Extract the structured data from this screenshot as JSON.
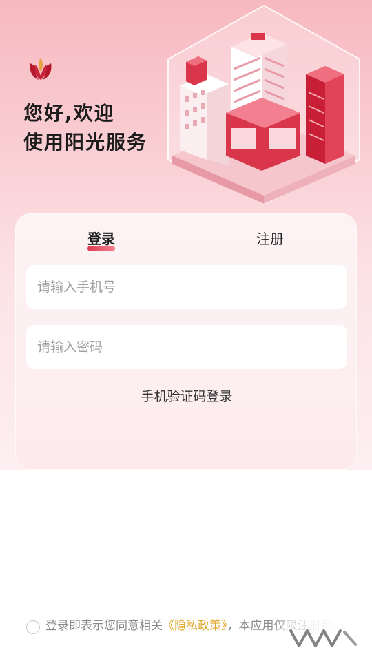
{
  "header": {
    "greeting_line1": "您好,欢迎",
    "greeting_line2": "使用阳光服务"
  },
  "tabs": [
    {
      "label": "登录",
      "active": true
    },
    {
      "label": "注册",
      "active": false
    }
  ],
  "form": {
    "phone_placeholder": "请输入手机号",
    "phone_value": "",
    "password_placeholder": "请输入密码",
    "password_value": "",
    "sms_login_label": "手机验证码登录"
  },
  "agreement": {
    "checked": false,
    "text_before": "登录即表示您同意相关",
    "policy_link": "《隐私政策》",
    "text_after": "，本应用仅限注册用户使用"
  },
  "icons": {
    "logo": "tulip-logo-icon",
    "illustration": "city-buildings-illustration",
    "watermark": "brand-watermark"
  },
  "colors": {
    "accent": "#d81e34",
    "policy_link": "#e0a82e",
    "hero_top": "#f7b9c0",
    "card_bg": "#fdf3f4"
  }
}
